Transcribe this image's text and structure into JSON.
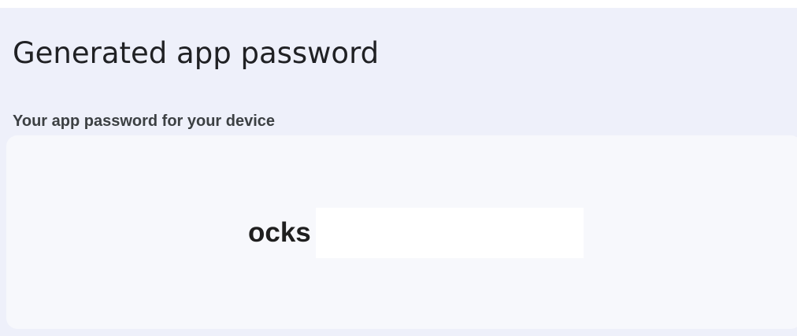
{
  "dialog": {
    "title": "Generated app password",
    "subtitle": "Your app password for your device",
    "password_visible_text": "ocks",
    "colors": {
      "background": "#eef0fa",
      "password_box": "#f7f8fc",
      "redaction": "#ffffff",
      "text_primary": "#202124"
    }
  }
}
